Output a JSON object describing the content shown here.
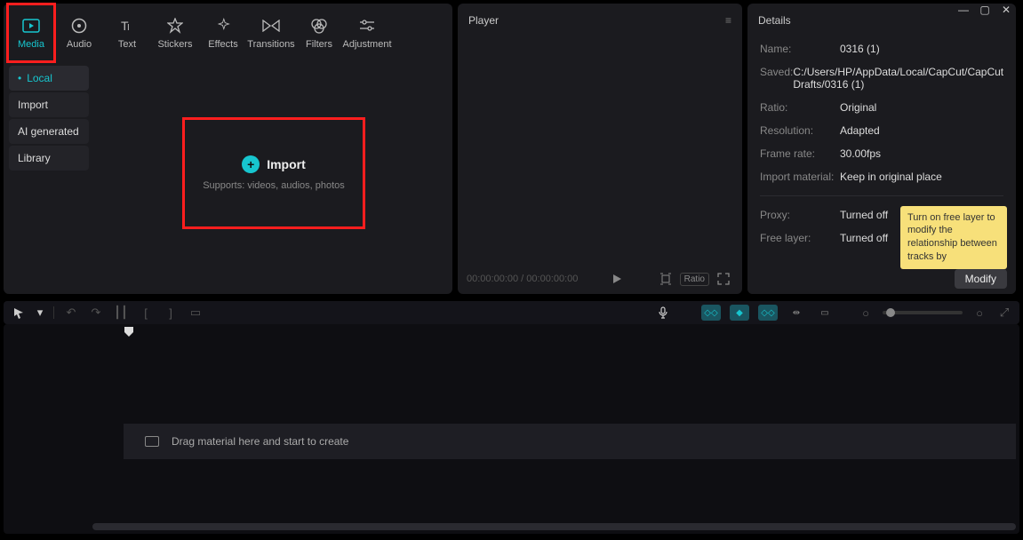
{
  "window": {
    "min": "—",
    "max": "▢",
    "close": "✕"
  },
  "topTabs": [
    {
      "key": "media",
      "label": "Media"
    },
    {
      "key": "audio",
      "label": "Audio"
    },
    {
      "key": "text",
      "label": "Text"
    },
    {
      "key": "stickers",
      "label": "Stickers"
    },
    {
      "key": "effects",
      "label": "Effects"
    },
    {
      "key": "transitions",
      "label": "Transitions"
    },
    {
      "key": "filters",
      "label": "Filters"
    },
    {
      "key": "adjustment",
      "label": "Adjustment"
    }
  ],
  "sidebar": {
    "items": [
      {
        "key": "local",
        "label": "Local",
        "active": true
      },
      {
        "key": "import",
        "label": "Import"
      },
      {
        "key": "ai",
        "label": "AI generated"
      },
      {
        "key": "library",
        "label": "Library"
      }
    ]
  },
  "importBox": {
    "title": "Import",
    "subtitle": "Supports: videos, audios, photos"
  },
  "player": {
    "title": "Player",
    "timecode": "00:00:00:00 / 00:00:00:00",
    "ratioLabel": "Ratio"
  },
  "details": {
    "title": "Details",
    "rows": [
      {
        "label": "Name:",
        "value": "0316 (1)"
      },
      {
        "label": "Saved:",
        "value": "C:/Users/HP/AppData/Local/CapCut/CapCut Drafts/0316 (1)"
      },
      {
        "label": "Ratio:",
        "value": "Original"
      },
      {
        "label": "Resolution:",
        "value": "Adapted"
      },
      {
        "label": "Frame rate:",
        "value": "30.00fps"
      },
      {
        "label": "Import material:",
        "value": "Keep in original place"
      }
    ],
    "rows2": [
      {
        "label": "Proxy:",
        "value": "Turned off"
      },
      {
        "label": "Free layer:",
        "value": "Turned off"
      }
    ],
    "tooltip": "Turn on free layer to modify the relationship between tracks by",
    "modify": "Modify"
  },
  "timeline": {
    "dropHint": "Drag material here and start to create"
  }
}
